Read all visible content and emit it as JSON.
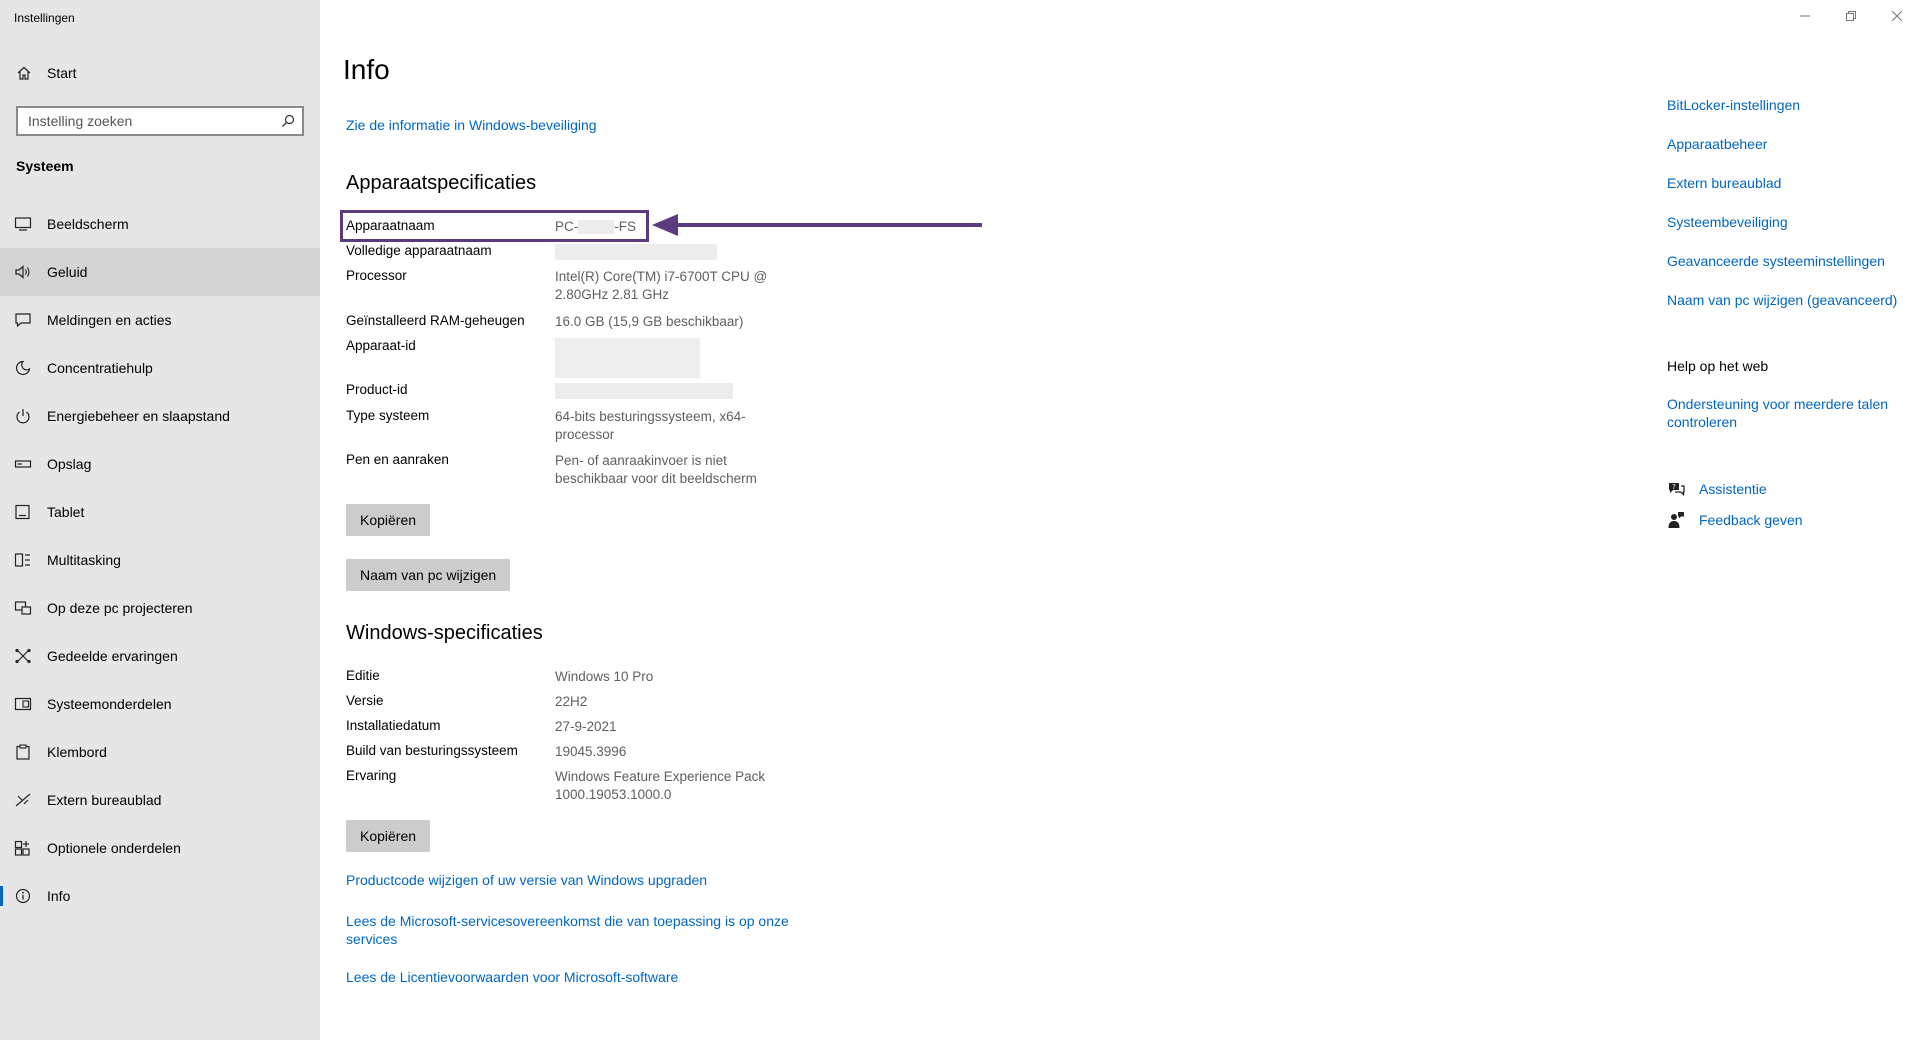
{
  "window": {
    "title": "Instellingen"
  },
  "sidebar": {
    "home_label": "Start",
    "search_placeholder": "Instelling zoeken",
    "section_label": "Systeem",
    "items": [
      {
        "label": "Beeldscherm",
        "icon": "display-icon"
      },
      {
        "label": "Geluid",
        "icon": "speaker-icon"
      },
      {
        "label": "Meldingen en acties",
        "icon": "notification-icon"
      },
      {
        "label": "Concentratiehulp",
        "icon": "moon-icon"
      },
      {
        "label": "Energiebeheer en slaapstand",
        "icon": "power-icon"
      },
      {
        "label": "Opslag",
        "icon": "storage-icon"
      },
      {
        "label": "Tablet",
        "icon": "tablet-icon"
      },
      {
        "label": "Multitasking",
        "icon": "multitasking-icon"
      },
      {
        "label": "Op deze pc projecteren",
        "icon": "project-icon"
      },
      {
        "label": "Gedeelde ervaringen",
        "icon": "shared-icon"
      },
      {
        "label": "Systeemonderdelen",
        "icon": "components-icon"
      },
      {
        "label": "Klembord",
        "icon": "clipboard-icon"
      },
      {
        "label": "Extern bureaublad",
        "icon": "remote-icon"
      },
      {
        "label": "Optionele onderdelen",
        "icon": "optional-icon"
      },
      {
        "label": "Info",
        "icon": "info-icon"
      }
    ],
    "hovered": "Geluid",
    "selected": "Info"
  },
  "main": {
    "title": "Info",
    "security_link": "Zie de informatie in Windows-beveiliging",
    "device_specs": {
      "heading": "Apparaatspecificaties",
      "rows": [
        {
          "key": "Apparaatnaam",
          "value": "PC-",
          "value_suffix": "-FS"
        },
        {
          "key": "Volledige apparaatnaam",
          "value": ""
        },
        {
          "key": "Processor",
          "value": "Intel(R) Core(TM) i7-6700T CPU @ 2.80GHz   2.81 GHz"
        },
        {
          "key": "Geïnstalleerd RAM-geheugen",
          "value": "16.0 GB (15,9 GB beschikbaar)"
        },
        {
          "key": "Apparaat-id",
          "value": ""
        },
        {
          "key": "Product-id",
          "value": ""
        },
        {
          "key": "Type systeem",
          "value": "64-bits besturingssysteem, x64-processor"
        },
        {
          "key": "Pen en aanraken",
          "value": "Pen- of aanraakinvoer is niet beschikbaar voor dit beeldscherm"
        }
      ],
      "copy_button": "Kopiëren",
      "rename_button": "Naam van pc wijzigen"
    },
    "windows_specs": {
      "heading": "Windows-specificaties",
      "rows": [
        {
          "key": "Editie",
          "value": "Windows 10 Pro"
        },
        {
          "key": "Versie",
          "value": "22H2"
        },
        {
          "key": "Installatiedatum",
          "value": "27-9-2021"
        },
        {
          "key": "Build van besturingssysteem",
          "value": "19045.3996"
        },
        {
          "key": "Ervaring",
          "value": "Windows Feature Experience Pack 1000.19053.1000.0"
        }
      ],
      "copy_button": "Kopiëren"
    },
    "bottom_links": [
      "Productcode wijzigen of uw versie van Windows upgraden",
      "Lees de Microsoft-servicesovereenkomst die van toepassing is op onze services",
      "Lees de Licentievoorwaarden voor Microsoft-software"
    ]
  },
  "related": {
    "links": [
      "BitLocker-instellingen",
      "Apparaatbeheer",
      "Extern bureaublad",
      "Systeembeveiliging",
      "Geavanceerde systeeminstellingen",
      "Naam van pc wijzigen (geavanceerd)"
    ],
    "help_heading": "Help op het web",
    "help_link": "Ondersteuning voor meerdere talen controleren",
    "support": [
      {
        "label": "Assistentie",
        "icon": "chat-help-icon"
      },
      {
        "label": "Feedback geven",
        "icon": "feedback-icon"
      }
    ]
  },
  "annotation": {
    "highlight_color": "#5b3a7e"
  }
}
